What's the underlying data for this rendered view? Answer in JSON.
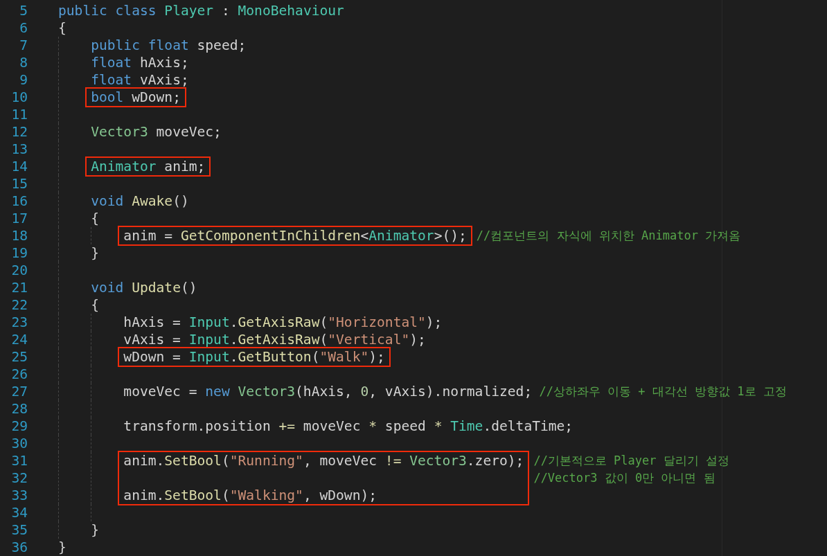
{
  "editor": {
    "items": [
      {
        "kind": "line",
        "number": "5",
        "tokens": [
          {
            "text": "public ",
            "kind": "keyword"
          },
          {
            "text": "class ",
            "kind": "keyword"
          },
          {
            "text": "Player",
            "kind": "type"
          },
          {
            "text": " : ",
            "kind": "plain"
          },
          {
            "text": "MonoBehaviour",
            "kind": "type"
          }
        ]
      },
      {
        "kind": "line",
        "number": "6",
        "tokens": [
          {
            "text": "{",
            "kind": "plain"
          }
        ]
      },
      {
        "kind": "block",
        "children": [
          {
            "kind": "line",
            "number": "7",
            "tokens": [
              {
                "text": "public ",
                "kind": "keyword"
              },
              {
                "text": "float",
                "kind": "keyword"
              },
              {
                "text": " speed;",
                "kind": "plain"
              }
            ]
          },
          {
            "kind": "line",
            "number": "8",
            "tokens": [
              {
                "text": "float",
                "kind": "keyword"
              },
              {
                "text": " hAxis;",
                "kind": "plain"
              }
            ]
          },
          {
            "kind": "line",
            "number": "9",
            "tokens": [
              {
                "text": "float",
                "kind": "keyword"
              },
              {
                "text": " vAxis;",
                "kind": "plain"
              }
            ]
          },
          {
            "kind": "box",
            "lines": [
              {
                "number": "10",
                "tokens": [
                  {
                    "text": "bool",
                    "kind": "keyword"
                  },
                  {
                    "text": " wDown;",
                    "kind": "plain"
                  }
                ]
              }
            ]
          },
          {
            "kind": "line",
            "number": "11"
          },
          {
            "kind": "line",
            "number": "12",
            "tokens": [
              {
                "text": "Vector3",
                "kind": "struct"
              },
              {
                "text": " moveVec;",
                "kind": "plain"
              }
            ]
          },
          {
            "kind": "line",
            "number": "13"
          },
          {
            "kind": "box",
            "lines": [
              {
                "number": "14",
                "tokens": [
                  {
                    "text": "Animator",
                    "kind": "type"
                  },
                  {
                    "text": " anim;",
                    "kind": "plain"
                  }
                ]
              }
            ]
          },
          {
            "kind": "line",
            "number": "15"
          },
          {
            "kind": "line",
            "number": "16",
            "tokens": [
              {
                "text": "void ",
                "kind": "keyword"
              },
              {
                "text": "Awake",
                "kind": "func"
              },
              {
                "text": "()",
                "kind": "plain"
              }
            ]
          },
          {
            "kind": "line",
            "number": "17",
            "tokens": [
              {
                "text": "{",
                "kind": "plain"
              }
            ]
          },
          {
            "kind": "block",
            "children": [
              {
                "kind": "box",
                "lines": [
                  {
                    "number": "18",
                    "tokens": [
                      {
                        "text": "anim = ",
                        "kind": "plain"
                      },
                      {
                        "text": "GetComponentInChildren",
                        "kind": "func"
                      },
                      {
                        "text": "<",
                        "kind": "plain"
                      },
                      {
                        "text": "Animator",
                        "kind": "type"
                      },
                      {
                        "text": ">();",
                        "kind": "plain"
                      }
                    ],
                    "comment": "//컴포넌트의 자식에 위치한 Animator 가져옴"
                  }
                ]
              }
            ]
          },
          {
            "kind": "line",
            "number": "19",
            "tokens": [
              {
                "text": "}",
                "kind": "plain"
              }
            ]
          },
          {
            "kind": "line",
            "number": "20"
          },
          {
            "kind": "line",
            "number": "21",
            "tokens": [
              {
                "text": "void ",
                "kind": "keyword"
              },
              {
                "text": "Update",
                "kind": "func"
              },
              {
                "text": "()",
                "kind": "plain"
              }
            ]
          },
          {
            "kind": "line",
            "number": "22",
            "tokens": [
              {
                "text": "{",
                "kind": "plain"
              }
            ]
          },
          {
            "kind": "block",
            "children": [
              {
                "kind": "line",
                "number": "23",
                "tokens": [
                  {
                    "text": "hAxis = ",
                    "kind": "plain"
                  },
                  {
                    "text": "Input",
                    "kind": "type"
                  },
                  {
                    "text": ".",
                    "kind": "plain"
                  },
                  {
                    "text": "GetAxisRaw",
                    "kind": "func"
                  },
                  {
                    "text": "(",
                    "kind": "plain"
                  },
                  {
                    "text": "\"Horizontal\"",
                    "kind": "string"
                  },
                  {
                    "text": ");",
                    "kind": "plain"
                  }
                ]
              },
              {
                "kind": "line",
                "number": "24",
                "tokens": [
                  {
                    "text": "vAxis = ",
                    "kind": "plain"
                  },
                  {
                    "text": "Input",
                    "kind": "type"
                  },
                  {
                    "text": ".",
                    "kind": "plain"
                  },
                  {
                    "text": "GetAxisRaw",
                    "kind": "func"
                  },
                  {
                    "text": "(",
                    "kind": "plain"
                  },
                  {
                    "text": "\"Vertical\"",
                    "kind": "string"
                  },
                  {
                    "text": ");",
                    "kind": "plain"
                  }
                ]
              },
              {
                "kind": "box",
                "lines": [
                  {
                    "number": "25",
                    "tokens": [
                      {
                        "text": "wDown = ",
                        "kind": "plain"
                      },
                      {
                        "text": "Input",
                        "kind": "type"
                      },
                      {
                        "text": ".",
                        "kind": "plain"
                      },
                      {
                        "text": "GetButton",
                        "kind": "func"
                      },
                      {
                        "text": "(",
                        "kind": "plain"
                      },
                      {
                        "text": "\"Walk\"",
                        "kind": "string"
                      },
                      {
                        "text": ");",
                        "kind": "plain"
                      }
                    ]
                  }
                ]
              },
              {
                "kind": "line",
                "number": "26"
              },
              {
                "kind": "line",
                "number": "27",
                "tokens": [
                  {
                    "text": "moveVec = ",
                    "kind": "plain"
                  },
                  {
                    "text": "new ",
                    "kind": "keyword"
                  },
                  {
                    "text": "Vector3",
                    "kind": "struct"
                  },
                  {
                    "text": "(hAxis, ",
                    "kind": "plain"
                  },
                  {
                    "text": "0",
                    "kind": "number"
                  },
                  {
                    "text": ", vAxis).normalized;",
                    "kind": "plain"
                  }
                ],
                "comment": "//상하좌우 이동 + 대각선 방향값 1로 고정"
              },
              {
                "kind": "line",
                "number": "28"
              },
              {
                "kind": "line",
                "number": "29",
                "tokens": [
                  {
                    "text": "transform.position ",
                    "kind": "plain"
                  },
                  {
                    "text": "+=",
                    "kind": "operator"
                  },
                  {
                    "text": " moveVec ",
                    "kind": "plain"
                  },
                  {
                    "text": "*",
                    "kind": "operator"
                  },
                  {
                    "text": " speed ",
                    "kind": "plain"
                  },
                  {
                    "text": "* ",
                    "kind": "operator"
                  },
                  {
                    "text": "Time",
                    "kind": "type"
                  },
                  {
                    "text": ".deltaTime;",
                    "kind": "plain"
                  }
                ]
              },
              {
                "kind": "line",
                "number": "30"
              },
              {
                "kind": "box",
                "lines": [
                  {
                    "number": "31",
                    "tokens": [
                      {
                        "text": "anim.",
                        "kind": "plain"
                      },
                      {
                        "text": "SetBool",
                        "kind": "func"
                      },
                      {
                        "text": "(",
                        "kind": "plain"
                      },
                      {
                        "text": "\"Running\"",
                        "kind": "string"
                      },
                      {
                        "text": ", moveVec ",
                        "kind": "plain"
                      },
                      {
                        "text": "!= ",
                        "kind": "operator"
                      },
                      {
                        "text": "Vector3",
                        "kind": "struct"
                      },
                      {
                        "text": ".zero);",
                        "kind": "plain"
                      }
                    ],
                    "comment": "//기본적으로 Player 달리기 설정"
                  },
                  {
                    "number": "32",
                    "comment": "//Vector3 값이 0만 아니면 됨"
                  },
                  {
                    "number": "33",
                    "tokens": [
                      {
                        "text": "anim.",
                        "kind": "plain"
                      },
                      {
                        "text": "SetBool",
                        "kind": "func"
                      },
                      {
                        "text": "(",
                        "kind": "plain"
                      },
                      {
                        "text": "\"Walking\"",
                        "kind": "string"
                      },
                      {
                        "text": ", wDown);",
                        "kind": "plain"
                      }
                    ]
                  }
                ]
              },
              {
                "kind": "line",
                "number": "34"
              }
            ]
          },
          {
            "kind": "line",
            "number": "35",
            "tokens": [
              {
                "text": "}",
                "kind": "plain"
              }
            ]
          }
        ]
      },
      {
        "kind": "line",
        "number": "36",
        "tokens": [
          {
            "text": "}",
            "kind": "plain"
          }
        ]
      }
    ]
  }
}
